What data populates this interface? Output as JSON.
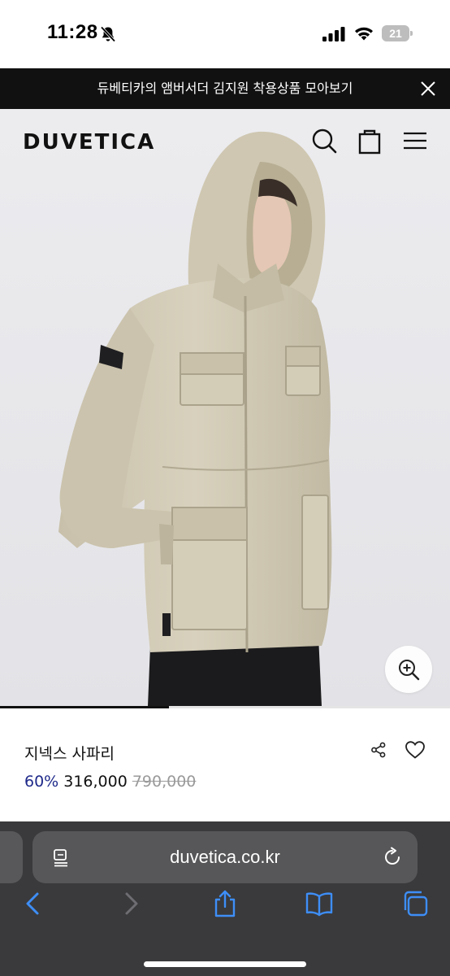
{
  "status_bar": {
    "time": "11:28",
    "battery_level": "21",
    "icons": [
      "bell-slash-icon",
      "signal-icon",
      "wifi-icon",
      "battery-icon"
    ]
  },
  "promo_banner": {
    "text": "듀베티카의 앰버서더 김지원 착용상품 모아보기",
    "close_icon": "close-icon"
  },
  "header": {
    "logo": "DUVETICA",
    "icons": [
      "search-icon",
      "shopping-bag-icon",
      "menu-icon"
    ]
  },
  "gallery": {
    "image": "product-photo",
    "zoom_icon": "zoom-in-icon",
    "progress_fraction": 0.375
  },
  "product": {
    "name": "지넥스 사파리",
    "discount": "60%",
    "price": "316,000",
    "original_price": "790,000",
    "icons": [
      "share-icon",
      "heart-icon"
    ]
  },
  "browser": {
    "url": "duvetica.co.kr",
    "icons": [
      "reader-icon",
      "reload-icon",
      "back-icon",
      "forward-icon",
      "share-icon",
      "bookmarks-icon",
      "tabs-icon"
    ]
  },
  "colors": {
    "banner_bg": "#111111",
    "discount": "#1f2a8a",
    "original_price": "#9a9a9a",
    "toolbar_bg": "#3a3a3c",
    "toolbar_icon": "#3e8ef7"
  }
}
